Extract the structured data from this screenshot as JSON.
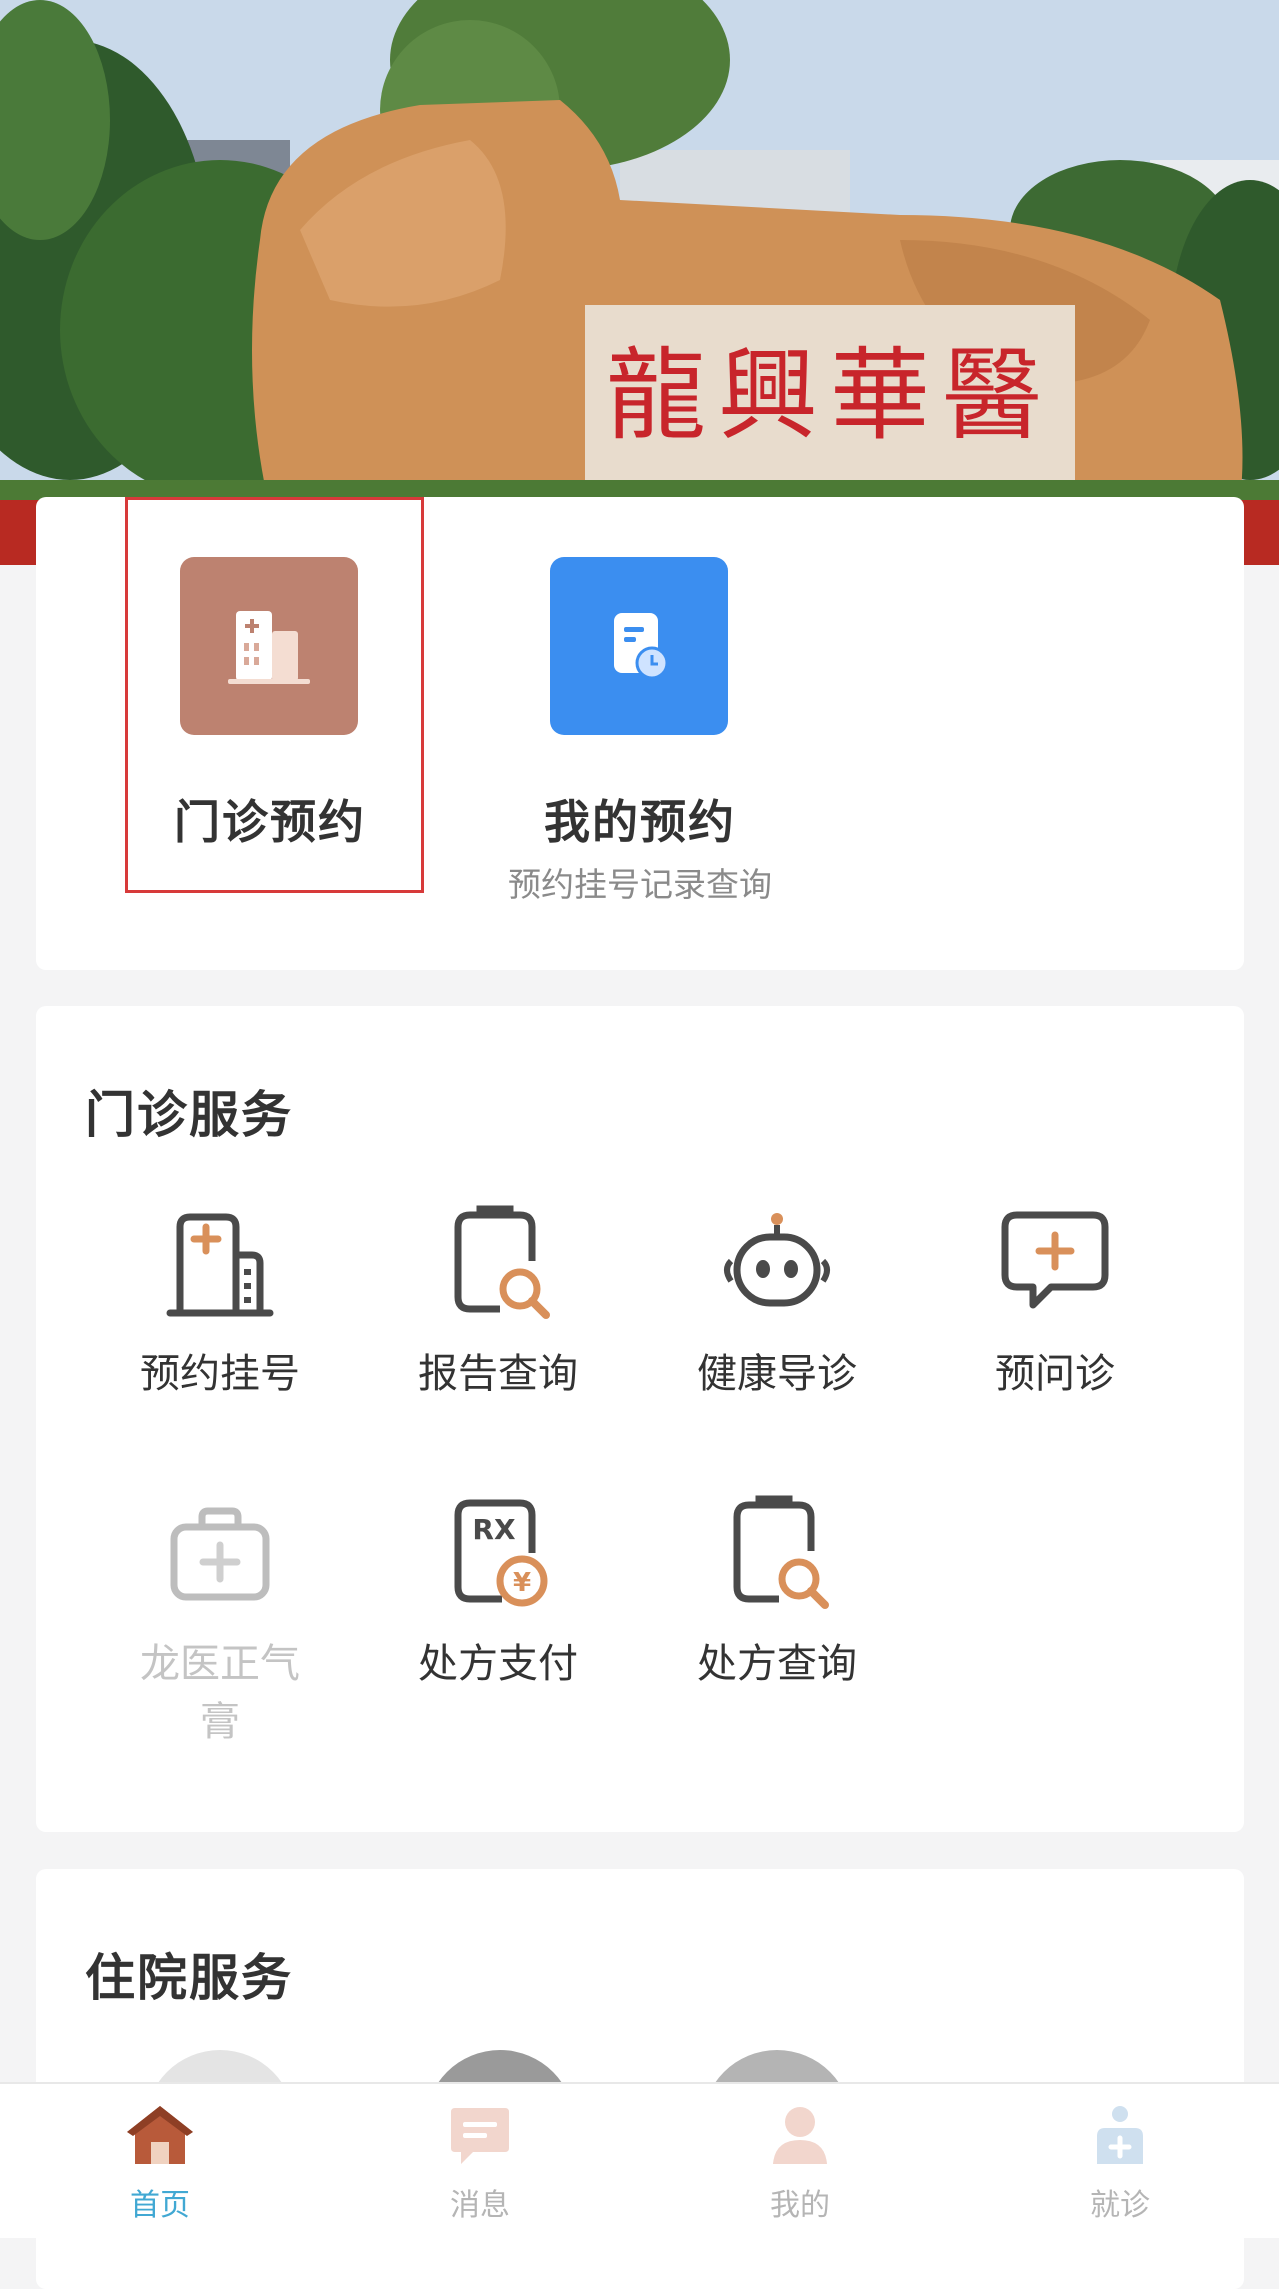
{
  "banner": {
    "stone_inscription": "龍興華醫"
  },
  "quick_actions": [
    {
      "title": "门诊预约",
      "subtitle": "",
      "icon": "hospital-building-icon",
      "color": "#bd8270",
      "highlighted": true
    },
    {
      "title": "我的预约",
      "subtitle": "预约挂号记录查询",
      "icon": "appointment-record-icon",
      "color": "#3b8ef0",
      "highlighted": false
    }
  ],
  "outpatient": {
    "title": "门诊服务",
    "items": [
      {
        "label": "预约挂号",
        "icon": "hospital-register-icon",
        "enabled": true
      },
      {
        "label": "报告查询",
        "icon": "report-search-icon",
        "enabled": true
      },
      {
        "label": "健康导诊",
        "icon": "robot-guide-icon",
        "enabled": true
      },
      {
        "label": "预问诊",
        "icon": "chat-plus-icon",
        "enabled": true
      },
      {
        "label": "龙医正气膏",
        "icon": "medical-kit-icon",
        "enabled": false
      },
      {
        "label": "处方支付",
        "icon": "rx-payment-icon",
        "enabled": true
      },
      {
        "label": "处方查询",
        "icon": "prescription-search-icon",
        "enabled": true
      }
    ]
  },
  "inpatient": {
    "title": "住院服务"
  },
  "tabbar": [
    {
      "label": "首页",
      "icon": "home-icon",
      "active": true
    },
    {
      "label": "消息",
      "icon": "message-icon",
      "active": false
    },
    {
      "label": "我的",
      "icon": "user-icon",
      "active": false
    },
    {
      "label": "就诊",
      "icon": "clinic-icon",
      "active": false
    }
  ],
  "colors": {
    "accent": "#41a8d3",
    "icon_dark": "#4a4a4a",
    "icon_orange": "#d9905a",
    "highlight_border": "#d73a3a"
  }
}
